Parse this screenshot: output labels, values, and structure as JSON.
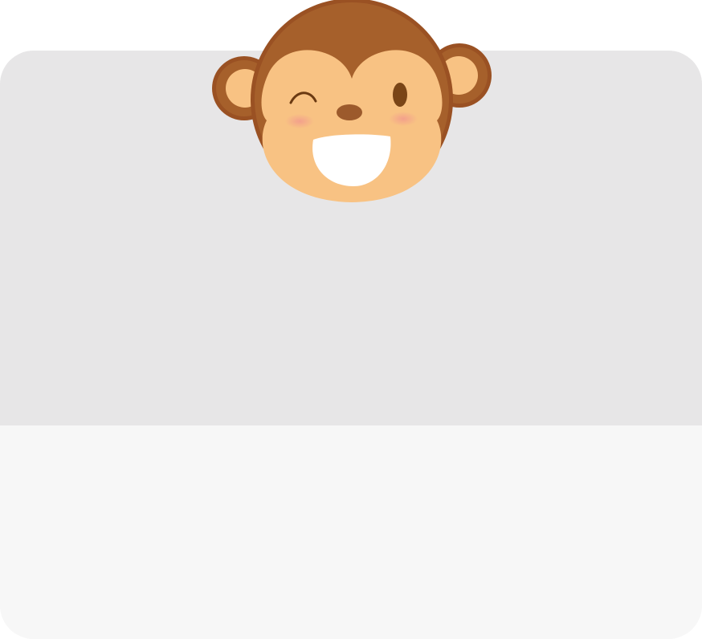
{
  "card": {
    "top_color": "#e7e6e7",
    "bottom_color": "#f7f7f7"
  },
  "mascot": {
    "icon": "monkey-face-icon",
    "expression": "winking-smile",
    "colors": {
      "fur": "#a6602b",
      "fur_edge": "#9a5123",
      "face": "#f8c283",
      "inner_ear": "#f8c283",
      "eye": "#7a4517",
      "nose": "#9c5a2c",
      "mouth": "#ffffff",
      "blush": "#f29a8d"
    }
  }
}
